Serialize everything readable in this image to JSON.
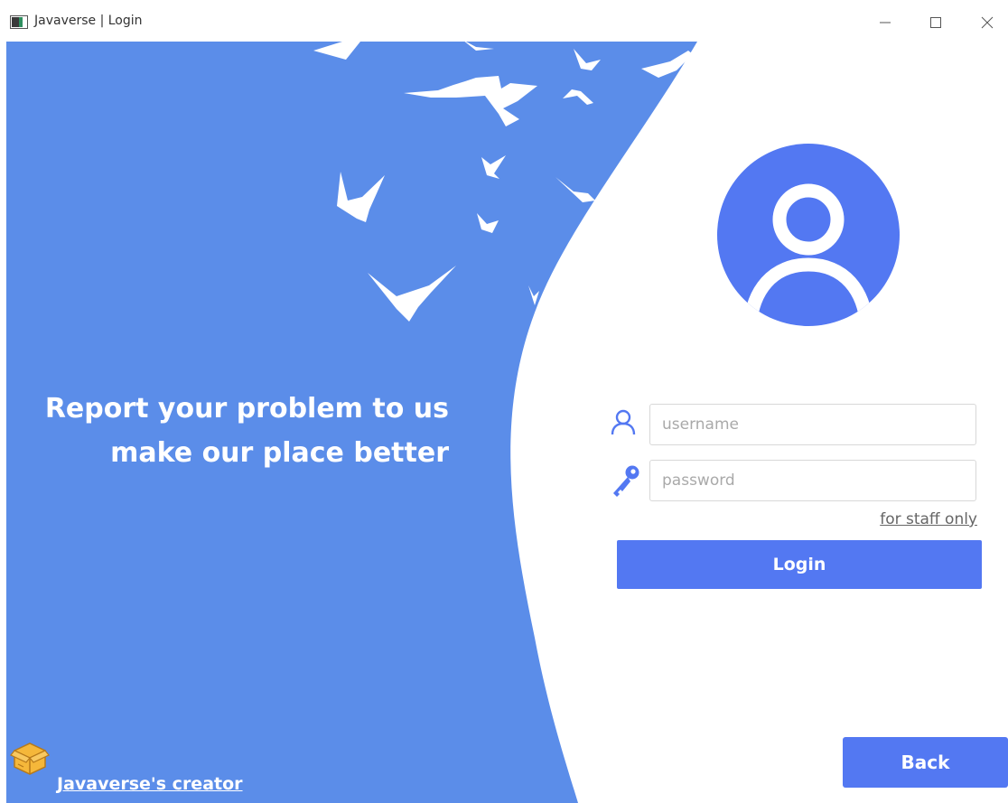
{
  "window": {
    "title": "Javaverse | Login",
    "controls": [
      "minimize",
      "maximize",
      "close"
    ]
  },
  "hero": {
    "line1": "Report your problem to us",
    "line2": "make our place better",
    "decoration": "flying-birds"
  },
  "login_form": {
    "avatar_icon": "user-avatar-icon",
    "username": {
      "icon": "user-icon",
      "placeholder": "username",
      "value": ""
    },
    "password": {
      "icon": "key-icon",
      "placeholder": "password",
      "value": ""
    },
    "staff_link": "for staff only",
    "login_label": "Login"
  },
  "footer": {
    "creator_icon": "package-box-icon",
    "creator_link": "Javaverse's creator",
    "back_label": "Back"
  },
  "colors": {
    "panel_blue": "#5b8de9",
    "accent_blue": "#5378f2",
    "white": "#ffffff",
    "box_orange": "#f5b73a"
  }
}
